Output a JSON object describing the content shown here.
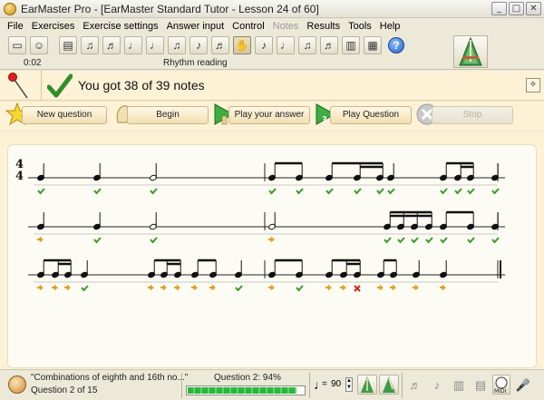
{
  "window": {
    "title": "EarMaster Pro - [EarMaster Standard Tutor - Lesson 24 of 60]",
    "minimize": "_",
    "maximize": "□",
    "close": "✕"
  },
  "menu": {
    "items": [
      {
        "label": "File",
        "enabled": true
      },
      {
        "label": "Exercises",
        "enabled": true
      },
      {
        "label": "Exercise settings",
        "enabled": true
      },
      {
        "label": "Answer input",
        "enabled": true
      },
      {
        "label": "Control",
        "enabled": true
      },
      {
        "label": "Notes",
        "enabled": false
      },
      {
        "label": "Results",
        "enabled": true
      },
      {
        "label": "Tools",
        "enabled": true
      },
      {
        "label": "Help",
        "enabled": true
      }
    ]
  },
  "toolbar": {
    "elapsed_time": "0:02",
    "exercise_type": "Rhythm reading",
    "help_glyph": "?"
  },
  "result": {
    "message": "You got 38 of 39 notes"
  },
  "actions": {
    "new_question": "New question",
    "begin": "Begin",
    "play_your_answer": "Play your answer",
    "play_question": "Play Question",
    "stop": "Stop"
  },
  "notation": {
    "time_signature_top": "4",
    "time_signature_bottom": "4"
  },
  "status": {
    "exercise_name": "\"Combinations of eighth and 16th no...\"",
    "question_position": "Question 2 of 15",
    "score_label": "Question 2: 94%",
    "score_percent": 94,
    "tempo_value": "90",
    "tempo_eq": "="
  },
  "colors": {
    "correct": "#3a9a2a",
    "wrong": "#d02020",
    "early_late": "#e0a020",
    "panel_bg": "#fdf1d6"
  }
}
